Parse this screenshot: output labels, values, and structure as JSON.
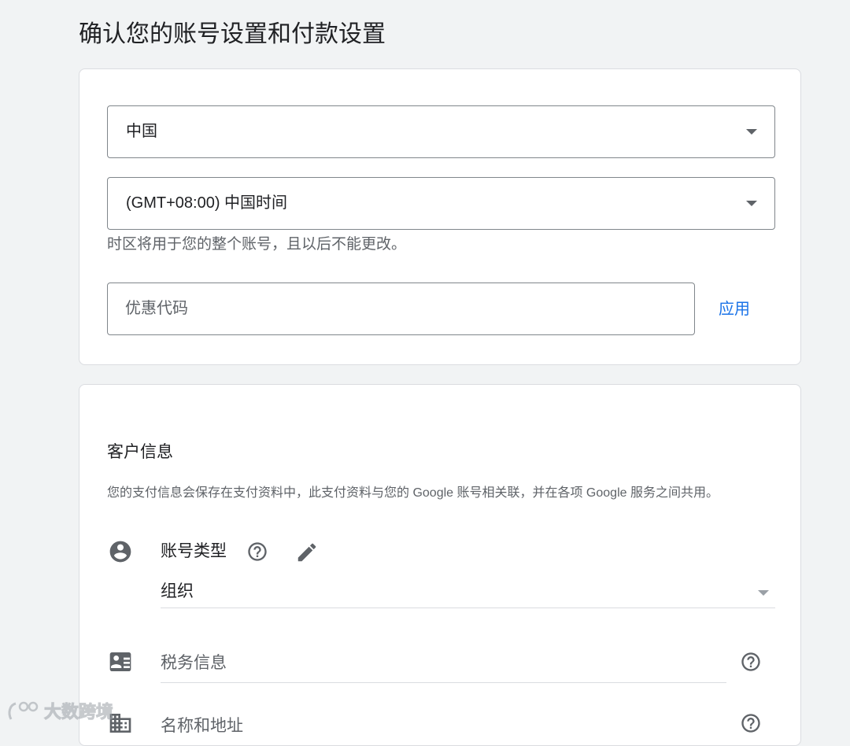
{
  "page": {
    "title": "确认您的账号设置和付款设置"
  },
  "settings_card": {
    "country": {
      "value": "中国"
    },
    "timezone": {
      "value": "(GMT+08:00) 中国时间",
      "helper": "时区将用于您的整个账号，且以后不能更改。"
    },
    "promo": {
      "placeholder": "优惠代码",
      "value": "",
      "apply_label": "应用"
    }
  },
  "customer_card": {
    "title": "客户信息",
    "description": "您的支付信息会保存在支付资料中，此支付资料与您的 Google 账号相关联，并在各项 Google 服务之间共用。",
    "account_type": {
      "label": "账号类型",
      "value": "组织"
    },
    "tax_info": {
      "label": "税务信息"
    },
    "name_address": {
      "label": "名称和地址"
    }
  },
  "icons": {
    "account": "account-circle-icon",
    "tax": "contact-card-icon",
    "business": "business-icon",
    "help": "help-circle-icon",
    "edit": "pencil-icon"
  },
  "watermark": {
    "text": "大数跨境"
  },
  "colors": {
    "accent": "#1a73e8",
    "background": "#f1f3f4",
    "border": "#dadce0",
    "icon": "#5f6368"
  }
}
